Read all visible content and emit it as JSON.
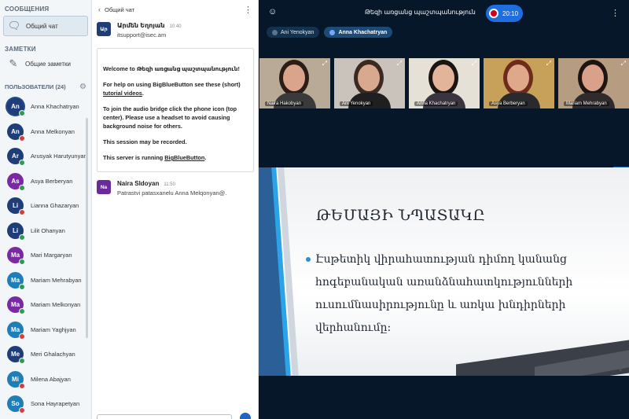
{
  "sidebar": {
    "messages_head": "СООБЩЕНИЯ",
    "public_chat": "Общий чат",
    "notes_head": "ЗАМЕТКИ",
    "shared_notes": "Общие заметки",
    "users_head": "ПОЛЬЗОВАТЕЛИ (24)",
    "users": [
      {
        "initials": "An",
        "name": "Anna Khachatryan",
        "color": "#1f3d78",
        "badge": "#2e9a52",
        "me": true
      },
      {
        "initials": "An",
        "name": "Anna Melkonyan",
        "color": "#1f3d78",
        "badge": "#d04040"
      },
      {
        "initials": "Ar",
        "name": "Arusyak Harutyunyan",
        "color": "#1f3d78",
        "badge": "#2e9a52"
      },
      {
        "initials": "As",
        "name": "Asya Berberyan",
        "color": "#7a2aa0",
        "badge": "#2e9a52"
      },
      {
        "initials": "Li",
        "name": "Lianna Ghazaryan",
        "color": "#1f3d78",
        "badge": "#d04040"
      },
      {
        "initials": "Li",
        "name": "Lilit Ohanyan",
        "color": "#1f3d78",
        "badge": "#2e9a52"
      },
      {
        "initials": "Ma",
        "name": "Mari Margaryan",
        "color": "#7a2aa0",
        "badge": "#2e9a52"
      },
      {
        "initials": "Ma",
        "name": "Mariam Mehrabyan",
        "color": "#1e7fb8",
        "badge": "#2e9a52"
      },
      {
        "initials": "Ma",
        "name": "Mariam Melkonyan",
        "color": "#7a2aa0",
        "badge": "#2e9a52"
      },
      {
        "initials": "Ma",
        "name": "Mariam Yaghjyan",
        "color": "#1e7fb8",
        "badge": "#d04040"
      },
      {
        "initials": "Me",
        "name": "Meri Ghalachyan",
        "color": "#1f3d78",
        "badge": "#2e9a52"
      },
      {
        "initials": "Mi",
        "name": "Milena Abajyan",
        "color": "#1e7fb8",
        "badge": "#d04040"
      },
      {
        "initials": "So",
        "name": "Sona Hayrapetyan",
        "color": "#1e7fb8",
        "badge": "#d04040"
      }
    ]
  },
  "chat": {
    "header": "Общий чат",
    "messages": [
      {
        "initials": "Ար",
        "author": "Արմեն Եղոյան",
        "time": "10:40",
        "text": "itsupport@isec.am",
        "color": "#1f3d78"
      },
      {
        "initials": "Na",
        "author": "Naira Sldoyan",
        "time": "11:50",
        "text": "Patrastvi patasxanelu Anna Melqonyan@.",
        "color": "#6a2a9a"
      }
    ],
    "welcome": {
      "p1": "Welcome to Թեզի առցանց պաշտպանություն!",
      "p2a": "For help on using BigBlueButton see these (short) ",
      "p2link": "tutorial videos",
      "p2b": ".",
      "p3": "To join the audio bridge click the phone icon (top center). Please use a headset to avoid causing background noise for others.",
      "p4": "This session may be recorded.",
      "p5a": "This server is running ",
      "p5link": "BigBlueButton",
      "p5b": "."
    }
  },
  "main": {
    "room_title": "Թեզի առցանց պաշտպանություն",
    "record_time": "20:10",
    "talkers": [
      {
        "name": "Ani Yenokyan",
        "active": false
      },
      {
        "name": "Anna Khachatryan",
        "active": true
      }
    ],
    "videos": [
      {
        "name": "Naira Hakobyan",
        "bg": "#b9aa98",
        "hair": "#2b1d16",
        "skin": "#d9a48b",
        "shirt": "#3a3a3a"
      },
      {
        "name": "Ani Yenokyan",
        "bg": "#c9c3bb",
        "hair": "#3a2a22",
        "skin": "#d8a98e",
        "shirt": "#1f1f22"
      },
      {
        "name": "Anna Khachatryan",
        "bg": "#e6e1d6",
        "hair": "#1a1412",
        "skin": "#e2b59b",
        "shirt": "#3a3440"
      },
      {
        "name": "Asya Berberyan",
        "bg": "#c7a15a",
        "hair": "#6e2a1c",
        "skin": "#e0a88a",
        "shirt": "#2a2a2e"
      },
      {
        "name": "Mariam Mehrabyan",
        "bg": "#b69c80",
        "hair": "#1e1512",
        "skin": "#d9a08a",
        "shirt": "#2f2a2c"
      }
    ],
    "slide": {
      "title": "ԹԵՄԱՅԻ ՆՊԱՏԱԿԸ",
      "bullet": "Էսթետիկ վիրահատության դիմող կանանց հոգեբանական առանձնահատկությունների ուսումնասիրությունը և առկա խնդիրների վերհանումը:"
    }
  }
}
